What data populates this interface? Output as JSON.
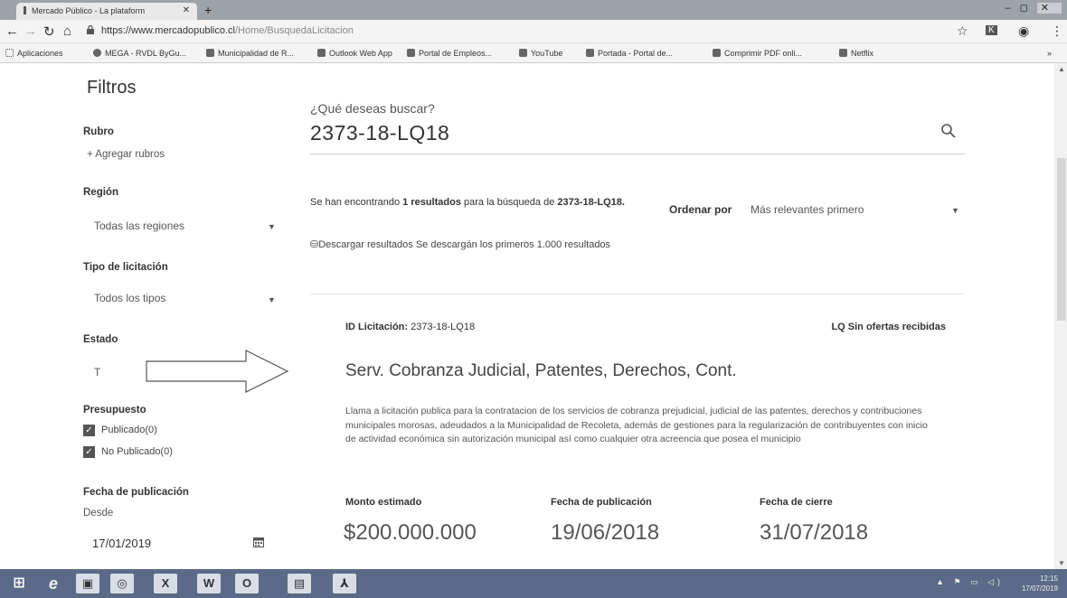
{
  "browser": {
    "tab_title": "Mercado Público - La plataform",
    "url_host": "https://www.mercadopublico.cl",
    "url_path": "/Home/BusquedaLicitacion",
    "bookmarks": [
      {
        "label": "Aplicaciones",
        "icon": "apps-grid-icon"
      },
      {
        "label": "MEGA - RVDL ByGu...",
        "icon": "mega-icon"
      },
      {
        "label": "Municipalidad de R...",
        "icon": "municipalidad-icon"
      },
      {
        "label": "Outlook Web App",
        "icon": "outlook-icon"
      },
      {
        "label": "Portal de Empleos...",
        "icon": "portal-icon"
      },
      {
        "label": "YouTube",
        "icon": "youtube-icon"
      },
      {
        "label": "Portada - Portal de...",
        "icon": "portada-icon"
      },
      {
        "label": "Comprimir PDF onli...",
        "icon": "pdf-icon"
      },
      {
        "label": "Netflix",
        "icon": "netflix-icon"
      }
    ],
    "more_bookmarks": "»"
  },
  "filters": {
    "title": "Filtros",
    "rubro_label": "Rubro",
    "rubro_add": "+ Agregar rubros",
    "region_label": "Región",
    "region_value": "Todas las regiones",
    "tipo_label": "Tipo de licitación",
    "tipo_value": "Todos los tipos",
    "estado_label": "Estado",
    "estado_value_partial": "T",
    "presupuesto_label": "Presupuesto",
    "publicado_label": "Publicado(0)",
    "no_publicado_label": "No Publicado(0)",
    "fecha_label": "Fecha de publicación",
    "desde_label": "Desde",
    "desde_value": "17/01/2019"
  },
  "search": {
    "prompt": "¿Qué deseas buscar?",
    "query": "2373-18-LQ18"
  },
  "results": {
    "prefix": "Se han encontrando ",
    "count": "1",
    "middle": " resultados",
    "suffix": " para la búsqueda de ",
    "term": "2373-18-LQ18.",
    "sort_label": "Ordenar por",
    "sort_value": "Más relevantes primero",
    "download": "Descargar resultados Se descargán los primeros 1.000 resultados"
  },
  "card": {
    "id_label": "ID Licitación:",
    "id_value": "2373-18-LQ18",
    "status": "LQ Sin ofertas recibidas",
    "title": "Serv. Cobranza Judicial, Patentes, Derechos, Cont.",
    "description": "Llama a licitación publica para la contratacion de los servicios de cobranza prejudicial, judicial de las patentes, derechos y contribuciones municipales morosas, adeudados a la Municipalidad de Recoleta, además de gestiones para la regularización de contribuyentes con inicio de actividad económica sin autorización municipal así como cualquier otra acreencia que posea el municipio",
    "monto_label": "Monto estimado",
    "monto_value": "$200.000.000",
    "pub_label": "Fecha de publicación",
    "pub_value": "19/06/2018",
    "cierre_label": "Fecha de cierre",
    "cierre_value": "31/07/2018"
  },
  "taskbar": {
    "time": "12:15",
    "date": "17/07/2019"
  }
}
